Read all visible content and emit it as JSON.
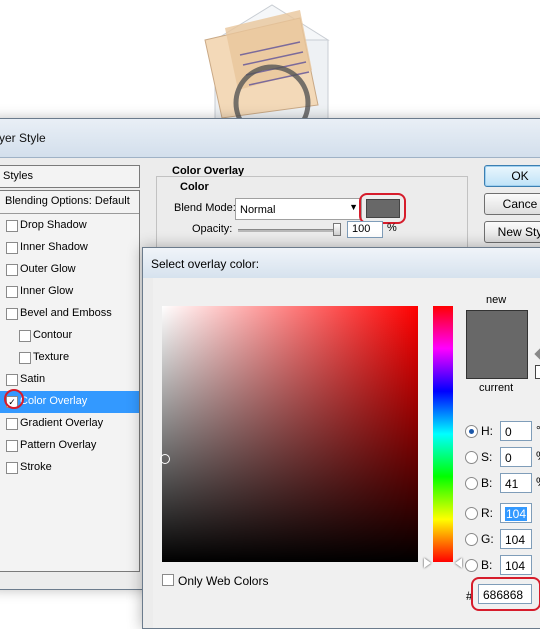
{
  "layer_style_dialog": {
    "title": "yer Style",
    "styles_header": "Styles",
    "items": [
      {
        "label": "Blending Options: Default",
        "checkbox": false,
        "checked": false
      },
      {
        "label": "Drop Shadow",
        "checkbox": true,
        "checked": false
      },
      {
        "label": "Inner Shadow",
        "checkbox": true,
        "checked": false
      },
      {
        "label": "Outer Glow",
        "checkbox": true,
        "checked": false
      },
      {
        "label": "Inner Glow",
        "checkbox": true,
        "checked": false
      },
      {
        "label": "Bevel and Emboss",
        "checkbox": true,
        "checked": false
      },
      {
        "label": "Contour",
        "checkbox": true,
        "checked": false
      },
      {
        "label": "Texture",
        "checkbox": true,
        "checked": false
      },
      {
        "label": "Satin",
        "checkbox": true,
        "checked": false
      },
      {
        "label": "Color Overlay",
        "checkbox": true,
        "checked": true,
        "selected": true
      },
      {
        "label": "Gradient Overlay",
        "checkbox": true,
        "checked": false
      },
      {
        "label": "Pattern Overlay",
        "checkbox": true,
        "checked": false
      },
      {
        "label": "Stroke",
        "checkbox": true,
        "checked": false
      }
    ],
    "color_overlay": {
      "section_title": "Color Overlay",
      "group_title": "Color",
      "blend_mode_label": "Blend Mode:",
      "blend_mode_value": "Normal",
      "opacity_label": "Opacity:",
      "opacity_value": "100",
      "opacity_unit": "%",
      "opacity_level": 1.0,
      "swatch_color": "#686868"
    },
    "buttons": {
      "ok": "OK",
      "cancel": "Cance",
      "new_style": "New Sty"
    }
  },
  "color_picker": {
    "title": "Select overlay color:",
    "new_label": "new",
    "current_label": "current",
    "new_color": "#686868",
    "current_color": "#686868",
    "hsb": {
      "h": {
        "label": "H:",
        "value": "0",
        "unit": "°",
        "checked": true
      },
      "s": {
        "label": "S:",
        "value": "0",
        "unit": "%",
        "checked": false
      },
      "b": {
        "label": "B:",
        "value": "41",
        "unit": "%",
        "checked": false
      }
    },
    "rgb": {
      "r": {
        "label": "R:",
        "value": "104",
        "checked": false
      },
      "g": {
        "label": "G:",
        "value": "104",
        "checked": false
      },
      "b": {
        "label": "B:",
        "value": "104",
        "checked": false
      }
    },
    "hex_label": "#",
    "hex_value": "686868",
    "only_web_colors": "Only Web Colors"
  },
  "colors": {
    "highlight": "#d61c2b",
    "selection": "#3399ff"
  }
}
